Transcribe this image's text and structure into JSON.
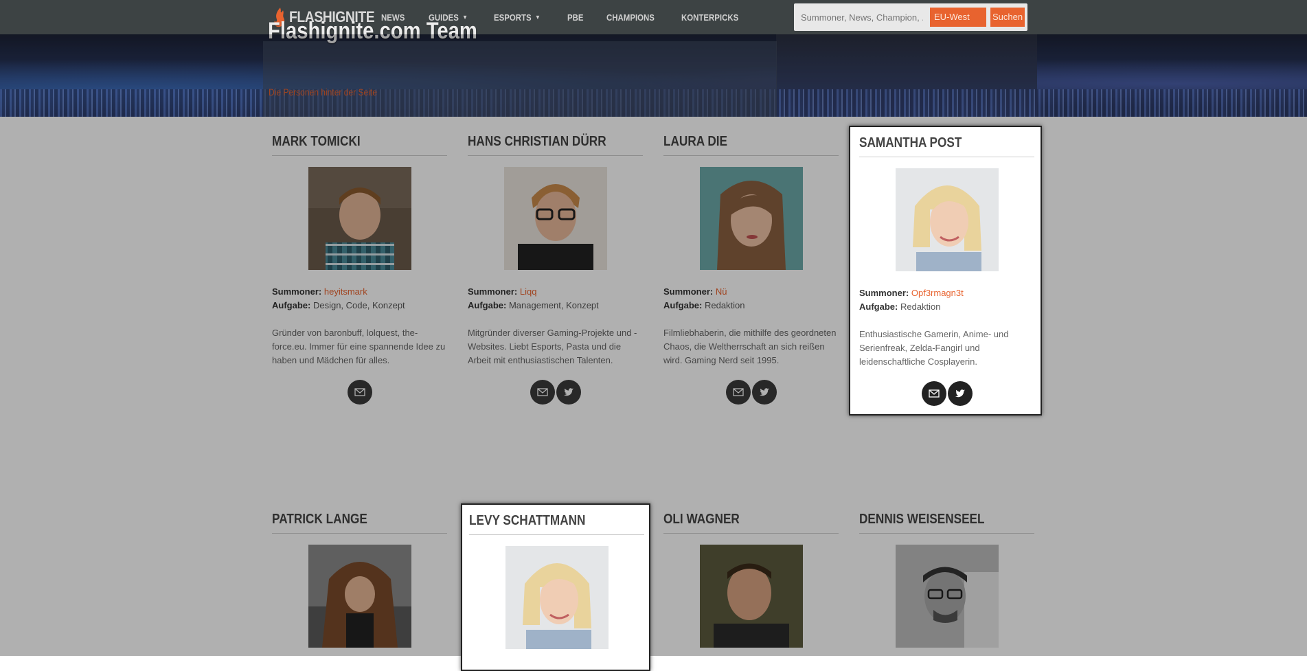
{
  "nav": {
    "logo": "FLASHIGNITE",
    "menu": [
      {
        "label": "NEWS",
        "caret": false
      },
      {
        "label": "GUIDES",
        "caret": true
      },
      {
        "label": "ESPORTS",
        "caret": true
      },
      {
        "label": "PBE",
        "caret": false
      },
      {
        "label": "CHAMPIONS",
        "caret": false
      },
      {
        "label": "KONTERPICKS",
        "caret": false
      }
    ],
    "search_placeholder": "Summoner, News, Champion, ...",
    "region": "EU-West",
    "search_button": "Suchen"
  },
  "hero": {
    "title": "Flashignite.com Team",
    "subtitle": "Die Personen hinter der Seite"
  },
  "labels": {
    "summoner": "Summoner:",
    "task": "Aufgabe:"
  },
  "team": [
    {
      "name": "MARK TOMICKI",
      "summoner": "heyitsmark",
      "task": "Design, Code, Konzept",
      "description": "Gründer von baronbuff, lolquest, the-force.eu. Immer für eine spannende Idee zu haben und Mädchen für alles.",
      "socials": [
        "mail"
      ]
    },
    {
      "name": "HANS CHRISTIAN DÜRR",
      "summoner": "Liqq",
      "task": "Management, Konzept",
      "description": "Mitgründer diverser Gaming-Projekte und -Websites. Liebt Esports, Pasta und die Arbeit mit enthusiastischen Talenten.",
      "socials": [
        "mail",
        "twitter"
      ]
    },
    {
      "name": "LAURA DIE",
      "summoner": "Nü",
      "task": "Redaktion",
      "description": "Filmliebhaberin, die mithilfe des geordneten Chaos, die Weltherrschaft an sich reißen wird. Gaming Nerd seit 1995.",
      "socials": [
        "mail",
        "twitter"
      ]
    },
    {
      "name": "SAMANTHA POST",
      "summoner": "Opf3rmagn3t",
      "task": "Redaktion",
      "description": "Enthusiastische Gamerin, Anime- und Serienfreak, Zelda-Fangirl und leidenschaftliche Cosplayerin.",
      "socials": [
        "mail",
        "twitter"
      ]
    },
    {
      "name": "PATRICK LANGE"
    },
    {
      "name": "LEVY SCHATTMANN"
    },
    {
      "name": "OLI WAGNER"
    },
    {
      "name": "DENNIS WEISENSEEL"
    }
  ],
  "colors": {
    "accent": "#e8632f",
    "nav_bg": "#3d4344"
  }
}
